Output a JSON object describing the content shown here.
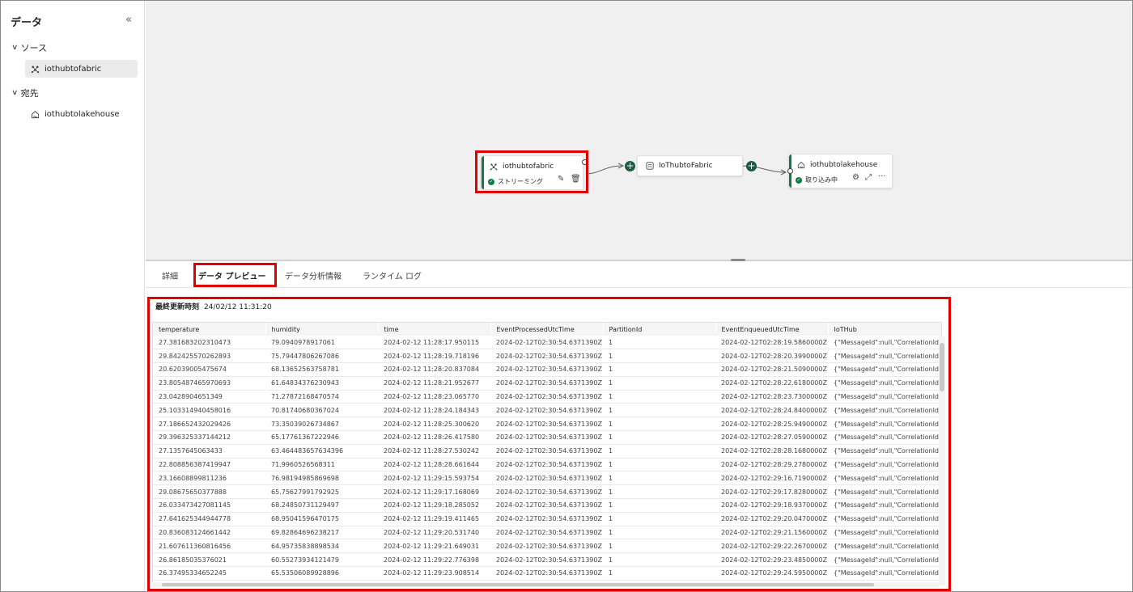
{
  "sidebar": {
    "title": "データ",
    "collapse_icon": "«",
    "sections": [
      {
        "label": "ソース",
        "items": [
          {
            "label": "iothubtofabric"
          }
        ]
      },
      {
        "label": "宛先",
        "items": [
          {
            "label": "iothubtolakehouse"
          }
        ]
      }
    ]
  },
  "canvas": {
    "source_node": {
      "title": "iothubtofabric",
      "status": "ストリーミング"
    },
    "stream_node": {
      "title": "IoThubtoFabric"
    },
    "dest_node": {
      "title": "iothubtolakehouse",
      "status": "取り込み中",
      "more": "···"
    },
    "plus_symbol": "+"
  },
  "tabs": [
    "詳細",
    "データ プレビュー",
    "データ分析情報",
    "ランタイム ログ"
  ],
  "preview": {
    "last_updated_label": "最終更新時刻",
    "last_updated_value": "24/02/12 11:31:20",
    "columns": [
      "temperature",
      "humidity",
      "time",
      "EventProcessedUtcTime",
      "PartitionId",
      "EventEnqueuedUtcTime",
      "IoTHub"
    ],
    "rows": [
      [
        "27.381683202310473",
        "79.0940978917061",
        "2024-02-12 11:28:17.950115",
        "2024-02-12T02:30:54.6371390Z",
        "1",
        "2024-02-12T02:28:19.5860000Z",
        "{\"MessageId\":null,\"CorrelationId\":null"
      ],
      [
        "29.842425570262893",
        "75.79447806267086",
        "2024-02-12 11:28:19.718196",
        "2024-02-12T02:30:54.6371390Z",
        "1",
        "2024-02-12T02:28:20.3990000Z",
        "{\"MessageId\":null,\"CorrelationId\":null"
      ],
      [
        "20.62039005475674",
        "68.13652563758781",
        "2024-02-12 11:28:20.837084",
        "2024-02-12T02:30:54.6371390Z",
        "1",
        "2024-02-12T02:28:21.5090000Z",
        "{\"MessageId\":null,\"CorrelationId\":null"
      ],
      [
        "23.805487465970693",
        "61.64834376230943",
        "2024-02-12 11:28:21.952677",
        "2024-02-12T02:30:54.6371390Z",
        "1",
        "2024-02-12T02:28:22.6180000Z",
        "{\"MessageId\":null,\"CorrelationId\":null"
      ],
      [
        "23.0428904651349",
        "71.27872168470574",
        "2024-02-12 11:28:23.065770",
        "2024-02-12T02:30:54.6371390Z",
        "1",
        "2024-02-12T02:28:23.7300000Z",
        "{\"MessageId\":null,\"CorrelationId\":null"
      ],
      [
        "25.103314940458016",
        "70.81740680367024",
        "2024-02-12 11:28:24.184343",
        "2024-02-12T02:30:54.6371390Z",
        "1",
        "2024-02-12T02:28:24.8400000Z",
        "{\"MessageId\":null,\"CorrelationId\":null"
      ],
      [
        "27.186652432029426",
        "73.35039026734867",
        "2024-02-12 11:28:25.300620",
        "2024-02-12T02:30:54.6371390Z",
        "1",
        "2024-02-12T02:28:25.9490000Z",
        "{\"MessageId\":null,\"CorrelationId\":null"
      ],
      [
        "29.396325337144212",
        "65.17761367222946",
        "2024-02-12 11:28:26.417580",
        "2024-02-12T02:30:54.6371390Z",
        "1",
        "2024-02-12T02:28:27.0590000Z",
        "{\"MessageId\":null,\"CorrelationId\":null"
      ],
      [
        "27.1357645063433",
        "63.464483657634396",
        "2024-02-12 11:28:27.530242",
        "2024-02-12T02:30:54.6371390Z",
        "1",
        "2024-02-12T02:28:28.1680000Z",
        "{\"MessageId\":null,\"CorrelationId\":null"
      ],
      [
        "22.808856387419947",
        "71.9960526568311",
        "2024-02-12 11:28:28.661644",
        "2024-02-12T02:30:54.6371390Z",
        "1",
        "2024-02-12T02:28:29.2780000Z",
        "{\"MessageId\":null,\"CorrelationId\":null"
      ],
      [
        "23.16608899811236",
        "76.98194985869698",
        "2024-02-12 11:29:15.593754",
        "2024-02-12T02:30:54.6371390Z",
        "1",
        "2024-02-12T02:29:16.7190000Z",
        "{\"MessageId\":null,\"CorrelationId\":null"
      ],
      [
        "29.08675650377888",
        "65.75627991792925",
        "2024-02-12 11:29:17.168069",
        "2024-02-12T02:30:54.6371390Z",
        "1",
        "2024-02-12T02:29:17.8280000Z",
        "{\"MessageId\":null,\"CorrelationId\":null"
      ],
      [
        "26.033473427081145",
        "68.24850731129497",
        "2024-02-12 11:29:18.285052",
        "2024-02-12T02:30:54.6371390Z",
        "1",
        "2024-02-12T02:29:18.9370000Z",
        "{\"MessageId\":null,\"CorrelationId\":null"
      ],
      [
        "27.641625344944778",
        "68.95041596470175",
        "2024-02-12 11:29:19.411465",
        "2024-02-12T02:30:54.6371390Z",
        "1",
        "2024-02-12T02:29:20.0470000Z",
        "{\"MessageId\":null,\"CorrelationId\":null"
      ],
      [
        "20.836083124661442",
        "69.82864696238217",
        "2024-02-12 11:29:20.531740",
        "2024-02-12T02:30:54.6371390Z",
        "1",
        "2024-02-12T02:29:21.1560000Z",
        "{\"MessageId\":null,\"CorrelationId\":null"
      ],
      [
        "21.607611360816456",
        "64.95735838898534",
        "2024-02-12 11:29:21.649031",
        "2024-02-12T02:30:54.6371390Z",
        "1",
        "2024-02-12T02:29:22.2670000Z",
        "{\"MessageId\":null,\"CorrelationId\":null"
      ],
      [
        "26.86185035376021",
        "60.55273934121479",
        "2024-02-12 11:29:22.776398",
        "2024-02-12T02:30:54.6371390Z",
        "1",
        "2024-02-12T02:29:23.4850000Z",
        "{\"MessageId\":null,\"CorrelationId\":null"
      ],
      [
        "26.37495334652245",
        "65.53506089928896",
        "2024-02-12 11:29:23.908514",
        "2024-02-12T02:30:54.6371390Z",
        "1",
        "2024-02-12T02:29:24.5950000Z",
        "{\"MessageId\":null,\"CorrelationId\":null"
      ]
    ]
  },
  "icons": {
    "source": "iot-hub-icon",
    "stream": "eventstream-icon",
    "dest": "lakehouse-icon"
  },
  "colors": {
    "accent": "#107c41",
    "highlight": "#e00000"
  }
}
